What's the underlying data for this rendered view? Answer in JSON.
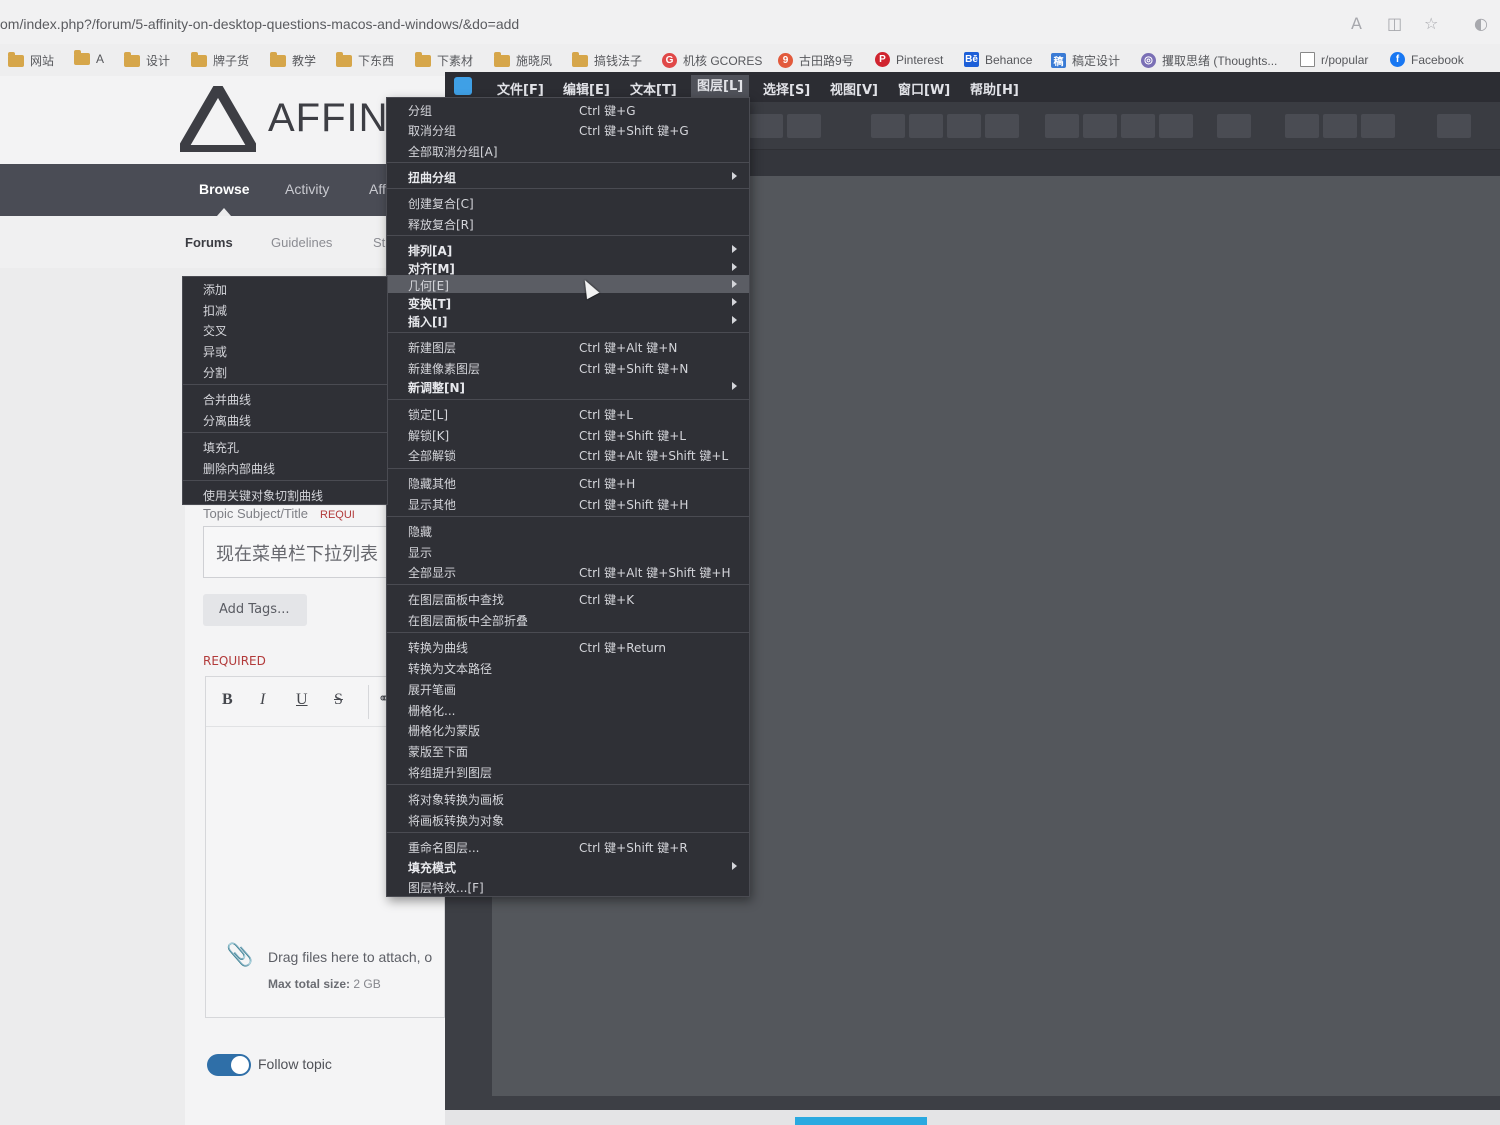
{
  "browser": {
    "url": "om/index.php?/forum/5-affinity-on-desktop-questions-macos-and-windows/&do=add",
    "bookmarks": [
      {
        "label": "网站",
        "icon": "folder-icon"
      },
      {
        "label": "A",
        "icon": "folder-icon"
      },
      {
        "label": "设计",
        "icon": "folder-icon"
      },
      {
        "label": "牌子货",
        "icon": "folder-icon"
      },
      {
        "label": "教学",
        "icon": "folder-icon"
      },
      {
        "label": "下东西",
        "icon": "folder-icon"
      },
      {
        "label": "下素材",
        "icon": "folder-icon"
      },
      {
        "label": "施晓凤",
        "icon": "folder-icon"
      },
      {
        "label": "搞钱法子",
        "icon": "folder-icon"
      },
      {
        "label": "机核 GCORES",
        "icon": "gcores-icon"
      },
      {
        "label": "古田路9号",
        "icon": "gtn9-icon"
      },
      {
        "label": "Pinterest",
        "icon": "pinterest-icon"
      },
      {
        "label": "Behance",
        "icon": "behance-icon"
      },
      {
        "label": "稿定设计",
        "icon": "gaoding-icon"
      },
      {
        "label": "攫取思绪 (Thoughts...",
        "icon": "thoughts-icon"
      },
      {
        "label": "r/popular",
        "icon": "page-icon"
      },
      {
        "label": "Facebook",
        "icon": "facebook-icon"
      }
    ]
  },
  "forum": {
    "brand": "AFFINI",
    "nav": {
      "browse": "Browse",
      "activity": "Activity",
      "aff": "Aff"
    },
    "subnav": {
      "forums": "Forums",
      "guidelines": "Guidelines",
      "st": "St"
    },
    "topic_label": "Topic Subject/Title",
    "topic_required": "REQUI",
    "title_value": "现在菜单栏下拉列表",
    "add_tags": "Add Tags...",
    "required": "REQUIRED",
    "editor_buttons": {
      "bold": "B",
      "italic": "I",
      "underline": "U",
      "strike": "S"
    },
    "drag_text": "Drag files here to attach, o",
    "max_size_label": "Max total size:",
    "max_size_value": "2 GB",
    "follow_topic": "Follow topic",
    "follow_on": true
  },
  "app": {
    "menus": [
      "文件[F]",
      "编辑[E]",
      "文本[T]",
      "图层[L]",
      "选择[S]",
      "视图[V]",
      "窗口[W]",
      "帮助[H]"
    ],
    "open_menu": "图层[L]",
    "layer_menu": [
      {
        "label": "分组",
        "shortcut": "Ctrl 键+G"
      },
      {
        "label": "取消分组",
        "shortcut": "Ctrl 键+Shift 键+G"
      },
      {
        "label": "全部取消分组[A]",
        "shortcut": ""
      },
      {
        "label": "扭曲分组",
        "shortcut": "",
        "submenu": true
      },
      {
        "label": "创建复合[C]",
        "shortcut": ""
      },
      {
        "label": "释放复合[R]",
        "shortcut": ""
      },
      {
        "label": "排列[A]",
        "shortcut": "",
        "submenu": true
      },
      {
        "label": "对齐[M]",
        "shortcut": "",
        "submenu": true
      },
      {
        "label": "几何[E]",
        "shortcut": "",
        "submenu": true,
        "highlighted": true
      },
      {
        "label": "变换[T]",
        "shortcut": "",
        "submenu": true
      },
      {
        "label": "插入[I]",
        "shortcut": "",
        "submenu": true
      },
      {
        "label": "新建图层",
        "shortcut": "Ctrl 键+Alt 键+N"
      },
      {
        "label": "新建像素图层",
        "shortcut": "Ctrl 键+Shift 键+N"
      },
      {
        "label": "新调整[N]",
        "shortcut": "",
        "submenu": true
      },
      {
        "label": "锁定[L]",
        "shortcut": "Ctrl 键+L"
      },
      {
        "label": "解锁[K]",
        "shortcut": "Ctrl 键+Shift 键+L"
      },
      {
        "label": "全部解锁",
        "shortcut": "Ctrl 键+Alt 键+Shift 键+L"
      },
      {
        "label": "隐藏其他",
        "shortcut": "Ctrl 键+H"
      },
      {
        "label": "显示其他",
        "shortcut": "Ctrl 键+Shift 键+H"
      },
      {
        "label": "隐藏",
        "shortcut": ""
      },
      {
        "label": "显示",
        "shortcut": ""
      },
      {
        "label": "全部显示",
        "shortcut": "Ctrl 键+Alt 键+Shift 键+H"
      },
      {
        "label": "在图层面板中查找",
        "shortcut": "Ctrl 键+K"
      },
      {
        "label": "在图层面板中全部折叠",
        "shortcut": ""
      },
      {
        "label": "转换为曲线",
        "shortcut": "Ctrl 键+Return"
      },
      {
        "label": "转换为文本路径",
        "shortcut": ""
      },
      {
        "label": "展开笔画",
        "shortcut": ""
      },
      {
        "label": "栅格化...",
        "shortcut": ""
      },
      {
        "label": "栅格化为蒙版",
        "shortcut": ""
      },
      {
        "label": "蒙版至下面",
        "shortcut": ""
      },
      {
        "label": "将组提升到图层",
        "shortcut": ""
      },
      {
        "label": "将对象转换为画板",
        "shortcut": ""
      },
      {
        "label": "将画板转换为对象",
        "shortcut": ""
      },
      {
        "label": "重命名图层...",
        "shortcut": "Ctrl 键+Shift 键+R"
      },
      {
        "label": "填充模式",
        "shortcut": "",
        "submenu": true
      },
      {
        "label": "图层特效...[F]",
        "shortcut": ""
      }
    ],
    "geometry_submenu": [
      "添加",
      "扣减",
      "交叉",
      "异或",
      "分割",
      "合并曲线",
      "分离曲线",
      "填充孔",
      "删除内部曲线",
      "使用关键对象切割曲线"
    ]
  },
  "colors": {
    "menu_bg": "#2f3036",
    "menu_highlight": "#5b5d64",
    "canvas": "#54575c",
    "accent": "#2f6fa8"
  }
}
